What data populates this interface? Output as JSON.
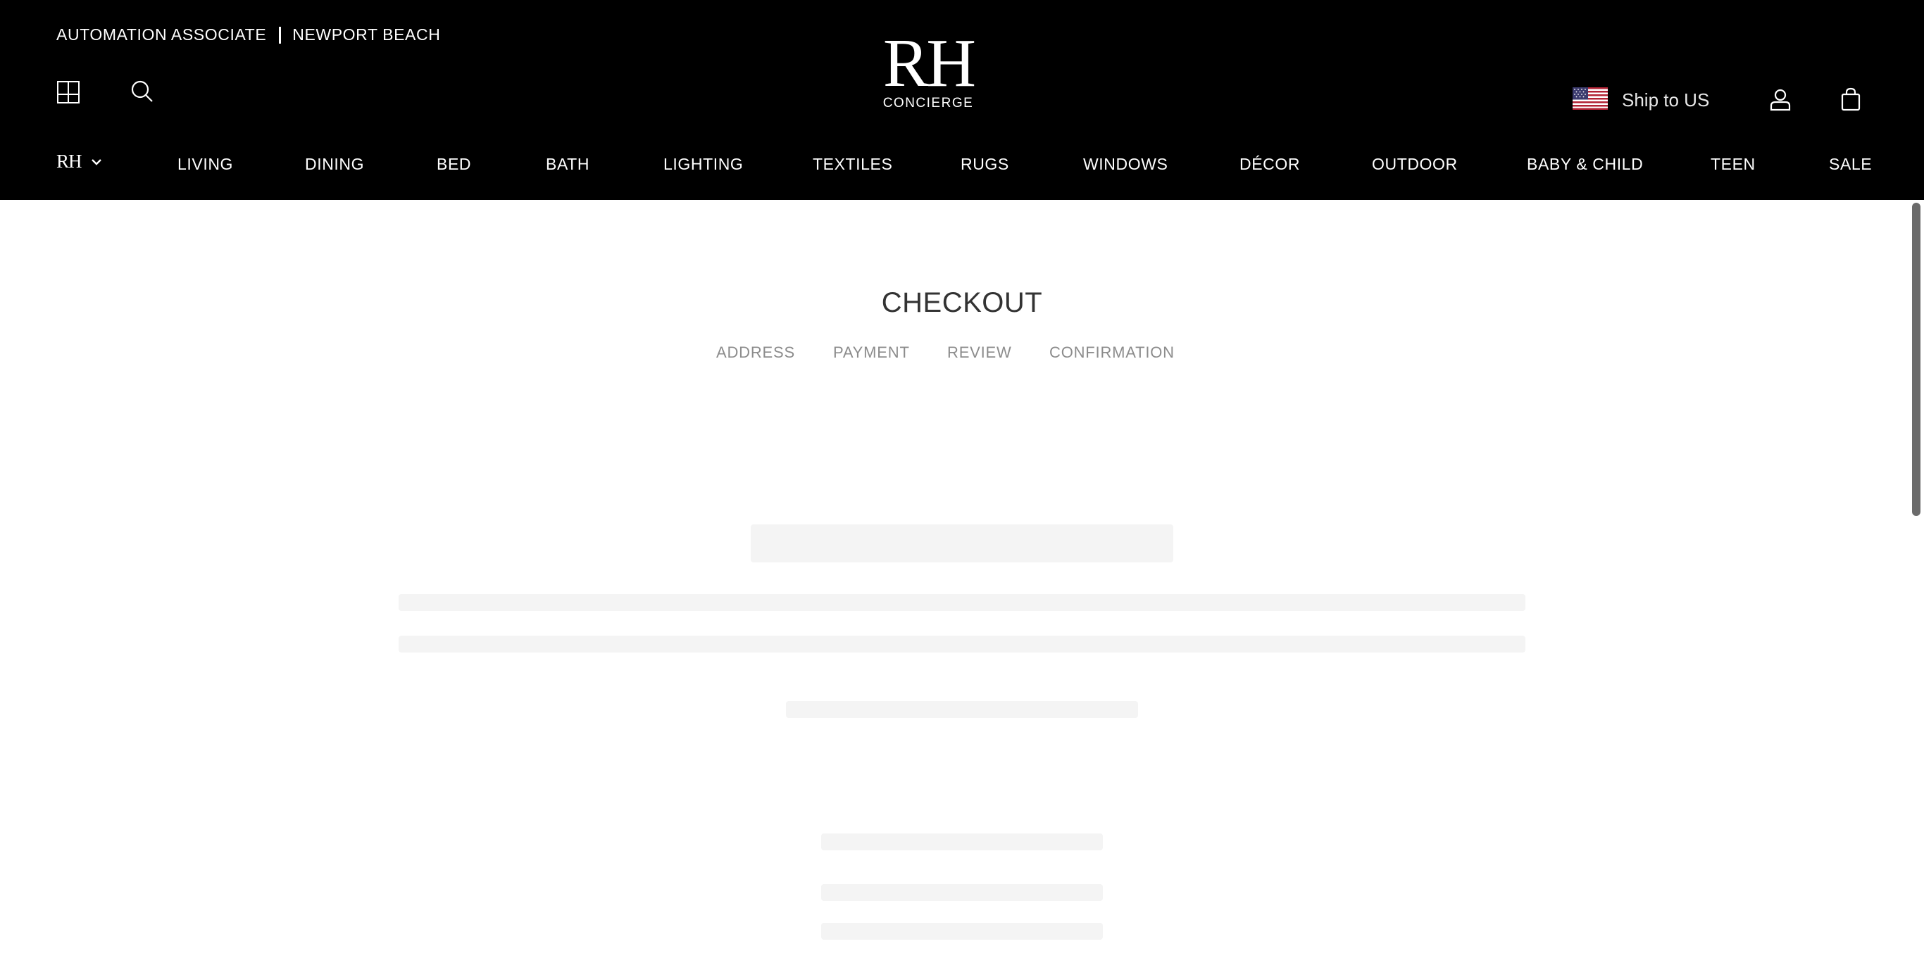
{
  "header": {
    "associate": "AUTOMATION ASSOCIATE",
    "location": "NEWPORT BEACH",
    "logo": {
      "mark": "RH",
      "subtitle": "CONCIERGE"
    },
    "ship_to": "Ship to US",
    "icons": {
      "gallery": "gallery-grid-icon",
      "search": "search-icon",
      "flag": "us-flag-icon",
      "account": "account-icon",
      "cart": "shopping-bag-icon",
      "brand_switch": "chevron-down-icon"
    }
  },
  "nav": {
    "brand": "RH",
    "items": [
      "LIVING",
      "DINING",
      "BED",
      "BATH",
      "LIGHTING",
      "TEXTILES",
      "RUGS",
      "WINDOWS",
      "DÉCOR",
      "OUTDOOR",
      "BABY & CHILD",
      "TEEN",
      "SALE"
    ]
  },
  "checkout": {
    "title": "CHECKOUT",
    "steps": [
      "ADDRESS",
      "PAYMENT",
      "REVIEW",
      "CONFIRMATION"
    ]
  },
  "colors": {
    "header_bg": "#000000",
    "page_bg": "#ffffff",
    "skeleton": "#f4f4f4",
    "step_text": "#8c8c8c"
  }
}
